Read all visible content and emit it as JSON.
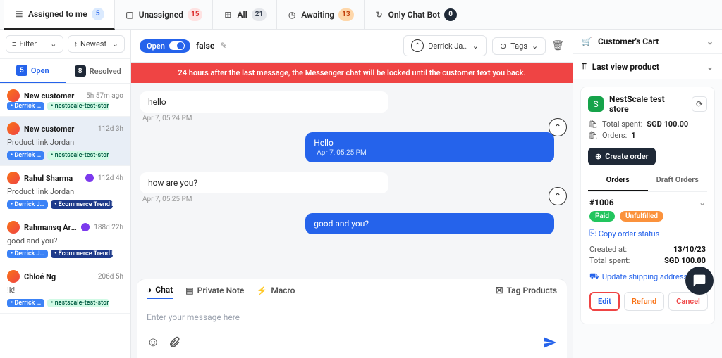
{
  "top_tabs": [
    {
      "icon": "user",
      "label": "Assigned to me",
      "count": "5",
      "badge": "b-blue"
    },
    {
      "icon": "inbox",
      "label": "Unassigned",
      "count": "15",
      "badge": "b-red"
    },
    {
      "icon": "grid",
      "label": "All",
      "count": "21",
      "badge": "b-gray"
    },
    {
      "icon": "clock",
      "label": "Awaiting",
      "count": "13",
      "badge": "b-orange"
    },
    {
      "icon": "bot",
      "label": "Only Chat Bot",
      "count": "0",
      "badge": "b-dark"
    }
  ],
  "sidebar": {
    "filter_label": "Filter",
    "sort_label": "Newest",
    "tab_open": {
      "count": "5",
      "label": "Open"
    },
    "tab_resolved": {
      "count": "8",
      "label": "Resolved"
    }
  },
  "conversations": [
    {
      "name": "New customer",
      "time": "5h 57m ago",
      "preview": "",
      "tags": [
        {
          "cls": "p-blue",
          "text": "Derrick …"
        },
        {
          "cls": "p-green",
          "text": "nestscale-test-store.my…"
        }
      ]
    },
    {
      "name": "New customer",
      "time": "112d 3h",
      "preview": "Product link Jordan",
      "tags": [
        {
          "cls": "p-blue",
          "text": "Derrick …"
        },
        {
          "cls": "p-green",
          "text": "nestscale-test-store.my…"
        }
      ]
    },
    {
      "name": "Rahul Sharma",
      "time": "112d 4h",
      "preview": "Product link Jordan",
      "ch": true,
      "tags": [
        {
          "cls": "p-blue",
          "text": "Derrick J…"
        },
        {
          "cls": "p-navy",
          "text": "Ecommerce Trend Nes…"
        }
      ]
    },
    {
      "name": "Rahmansq Arch",
      "time": "188d 22h",
      "preview": "good and you?",
      "ch": true,
      "tags": [
        {
          "cls": "p-blue",
          "text": "Derrick J…"
        },
        {
          "cls": "p-navy",
          "text": "Ecommerce Trend Nes…"
        }
      ]
    },
    {
      "name": "Chloé Ng",
      "time": "206d 5h",
      "preview": "!k!",
      "tags": [
        {
          "cls": "p-blue",
          "text": "Derrick …"
        },
        {
          "cls": "p-green",
          "text": "nestscale-test-store.my…"
        }
      ]
    }
  ],
  "chat": {
    "status": "Open",
    "title_field": "false",
    "assignee": "Derrick Ja…",
    "tags_label": "Tags",
    "warning": "24 hours after the last message, the Messenger chat will be locked until the customer text you back.",
    "messages": [
      {
        "who": "other",
        "text": "hello",
        "time": "Apr 7, 05:24 PM"
      },
      {
        "who": "me",
        "text": "Hello",
        "time": "Apr 7, 05:25 PM"
      },
      {
        "who": "other",
        "text": "how are you?",
        "time": "Apr 7, 05:25 PM"
      },
      {
        "who": "me",
        "text": "good and you?",
        "time": ""
      }
    ],
    "composer": {
      "tab_chat": "Chat",
      "tab_note": "Private Note",
      "tab_macro": "Macro",
      "tag_products": "Tag Products",
      "placeholder": "Enter your message here"
    }
  },
  "right": {
    "cart_title": "Customer's Cart",
    "last_view_title": "Last view product",
    "store": {
      "name": "NestScale test store",
      "total_label": "Total spent:",
      "total_value": "SGD 100.00",
      "orders_label": "Orders:",
      "orders_value": "1",
      "create_order": "Create order"
    },
    "tab_orders": "Orders",
    "tab_drafts": "Draft Orders",
    "order": {
      "id": "#1006",
      "paid": "Paid",
      "unfulfilled": "Unfulfilled",
      "copy": "Copy order status",
      "created_l": "Created at:",
      "created_v": "13/10/23",
      "total_l": "Total spent:",
      "total_v": "SGD 100.00",
      "update_addr": "Update shipping address",
      "edit": "Edit",
      "refund": "Refund",
      "cancel": "Cancel"
    }
  }
}
